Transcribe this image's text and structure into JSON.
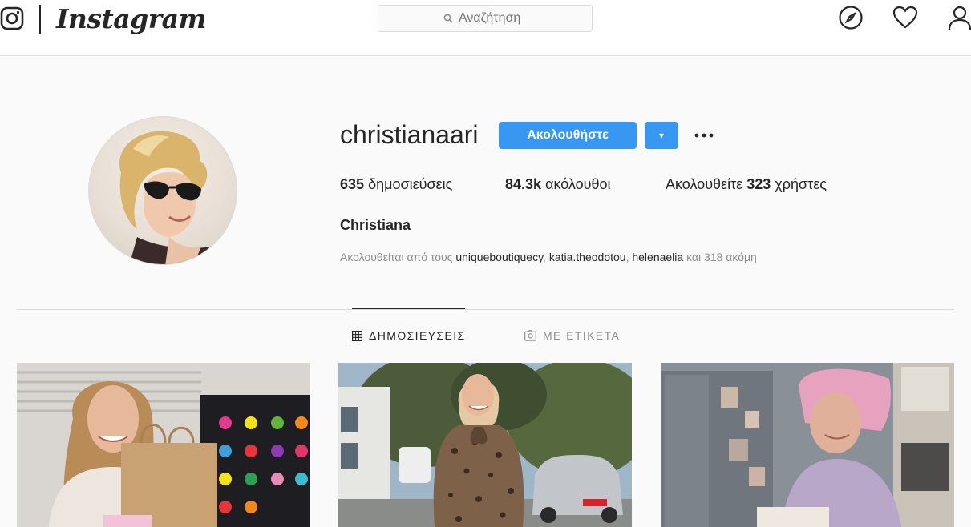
{
  "nav": {
    "brand": "Instagram",
    "search_placeholder": "Αναζήτηση",
    "icons": [
      "instagram-glyph-icon",
      "search-icon",
      "compass-icon",
      "heart-icon",
      "user-icon"
    ]
  },
  "profile": {
    "username": "christianaari",
    "follow_label": "Ακολουθήστε",
    "dropdown_icon": "▾",
    "more_icon": "•••",
    "stats": {
      "posts_count": "635",
      "posts_label": "δημοσιεύσεις",
      "followers_count": "84.3k",
      "followers_label": "ακόλουθοι",
      "following_prefix": "Ακολουθείτε",
      "following_count": "323",
      "following_label": "χρήστες"
    },
    "full_name": "Christiana",
    "followed_by": {
      "prefix": "Ακολουθείται από τους",
      "accounts": [
        "uniqueboutiquecy",
        "katia.theodotou",
        "helenaelia"
      ],
      "suffix": "και 318 ακόμη"
    }
  },
  "tabs": [
    {
      "label": "ΔΗΜΟΣΙΕΥΣΕΙΣ",
      "icon": "grid-icon",
      "active": true
    },
    {
      "label": "ΜΕ ΕΤΙΚΕΤΑ",
      "icon": "tagged-icon",
      "active": false
    }
  ],
  "posts": [
    {
      "name": "post-1"
    },
    {
      "name": "post-2"
    },
    {
      "name": "post-3"
    }
  ],
  "colors": {
    "accent": "#3897f0",
    "text": "#262626",
    "muted": "#8e8e8e",
    "border": "#dbdbdb",
    "background": "#fafafa"
  }
}
